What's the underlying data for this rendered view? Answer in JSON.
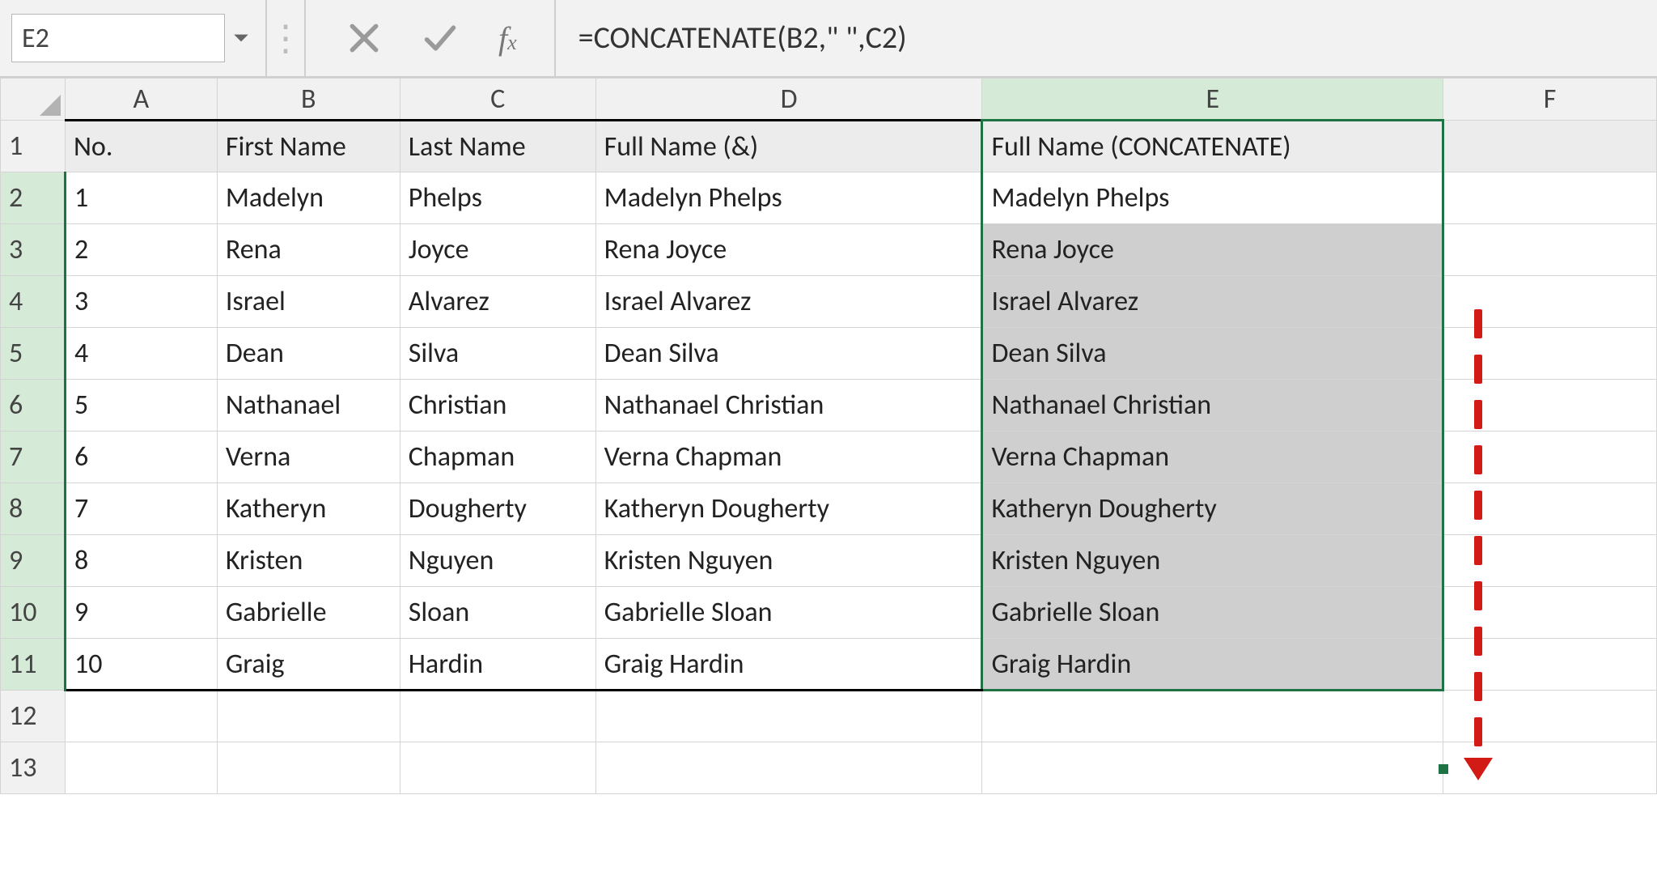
{
  "formula_bar": {
    "cell_ref": "E2",
    "formula": "=CONCATENATE(B2,\" \",C2)"
  },
  "columns": [
    "A",
    "B",
    "C",
    "D",
    "E",
    "F"
  ],
  "headers": {
    "A": "No.",
    "B": "First Name",
    "C": "Last Name",
    "D": "Full Name (&)",
    "E": "Full Name (CONCATENATE)"
  },
  "rows": [
    {
      "no": "1",
      "first": "Madelyn",
      "last": "Phelps",
      "full_amp": "Madelyn Phelps",
      "full_concat": "Madelyn Phelps"
    },
    {
      "no": "2",
      "first": "Rena",
      "last": "Joyce",
      "full_amp": "Rena Joyce",
      "full_concat": "Rena Joyce"
    },
    {
      "no": "3",
      "first": "Israel",
      "last": "Alvarez",
      "full_amp": "Israel Alvarez",
      "full_concat": "Israel Alvarez"
    },
    {
      "no": "4",
      "first": "Dean",
      "last": "Silva",
      "full_amp": "Dean Silva",
      "full_concat": "Dean Silva"
    },
    {
      "no": "5",
      "first": "Nathanael",
      "last": "Christian",
      "full_amp": "Nathanael Christian",
      "full_concat": "Nathanael Christian"
    },
    {
      "no": "6",
      "first": "Verna",
      "last": "Chapman",
      "full_amp": "Verna Chapman",
      "full_concat": "Verna Chapman"
    },
    {
      "no": "7",
      "first": "Katheryn",
      "last": "Dougherty",
      "full_amp": "Katheryn Dougherty",
      "full_concat": "Katheryn Dougherty"
    },
    {
      "no": "8",
      "first": "Kristen",
      "last": "Nguyen",
      "full_amp": "Kristen Nguyen",
      "full_concat": "Kristen Nguyen"
    },
    {
      "no": "9",
      "first": "Gabrielle",
      "last": "Sloan",
      "full_amp": "Gabrielle Sloan",
      "full_concat": "Gabrielle Sloan"
    },
    {
      "no": "10",
      "first": "Graig",
      "last": "Hardin",
      "full_amp": "Graig Hardin",
      "full_concat": "Graig Hardin"
    }
  ],
  "row_numbers": [
    "1",
    "2",
    "3",
    "4",
    "5",
    "6",
    "7",
    "8",
    "9",
    "10",
    "11",
    "12",
    "13"
  ],
  "active_rows": [
    "2",
    "3",
    "4",
    "5",
    "6",
    "7",
    "8",
    "9",
    "10",
    "11"
  ],
  "active_cell": "E2",
  "selection": "E2:E11",
  "active_column": "E"
}
